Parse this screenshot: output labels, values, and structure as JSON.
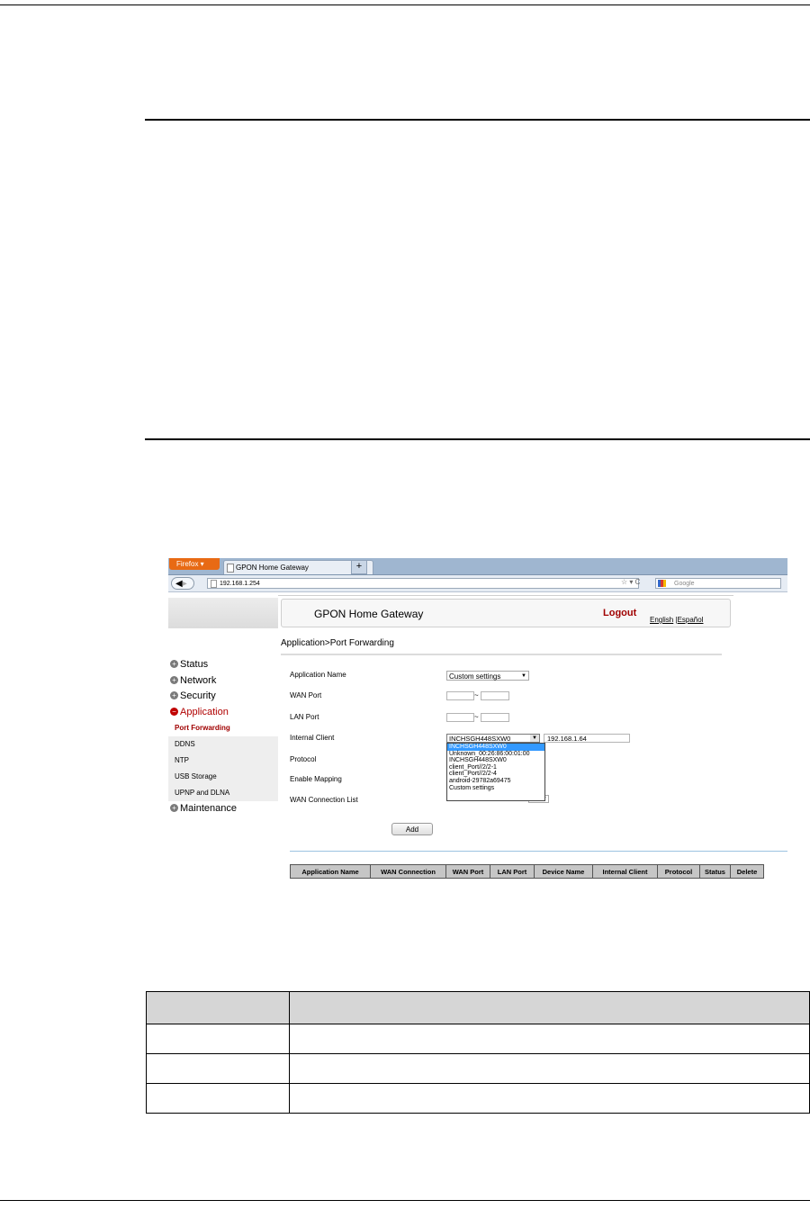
{
  "browser": {
    "app_button": "Firefox",
    "tab_title": "GPON Home Gateway",
    "new_tab": "+",
    "url": "192.168.1.254",
    "search_placeholder": "Google"
  },
  "header": {
    "title": "GPON Home Gateway",
    "logout": "Logout",
    "lang_english": "English",
    "lang_sep": "|",
    "lang_spanish": "Español"
  },
  "breadcrumb": "Application>Port Forwarding",
  "menu": {
    "status": "Status",
    "network": "Network",
    "security": "Security",
    "application": "Application",
    "sub": [
      "Port Forwarding",
      "DDNS",
      "NTP",
      "USB Storage",
      "UPNP and DLNA"
    ],
    "maintenance": "Maintenance"
  },
  "form": {
    "application_name_label": "Application Name",
    "application_name_value": "Custom settings",
    "wan_port_label": "WAN Port",
    "lan_port_label": "LAN Port",
    "port_sep": "~",
    "internal_client_label": "Internal Client",
    "internal_client_value": "INCHSGH448SXW0",
    "internal_client_ip": "192.168.1.64",
    "protocol_label": "Protocol",
    "enable_mapping_label": "Enable Mapping",
    "wan_connection_label": "WAN Connection List",
    "add_button": "Add"
  },
  "client_options": [
    "INCHSGH448SXW0",
    "Unknown_00:26:86:00:01:00",
    "INCHSGH448SXW0",
    "client_Port//2/2-1",
    "client_Port//2/2-4",
    "android-29782a69475",
    "Custom settings"
  ],
  "rules_table": {
    "columns": [
      "Application Name",
      "WAN Connection",
      "WAN Port",
      "LAN Port",
      "Device Name",
      "Internal Client",
      "Protocol",
      "Status",
      "Delete"
    ]
  }
}
